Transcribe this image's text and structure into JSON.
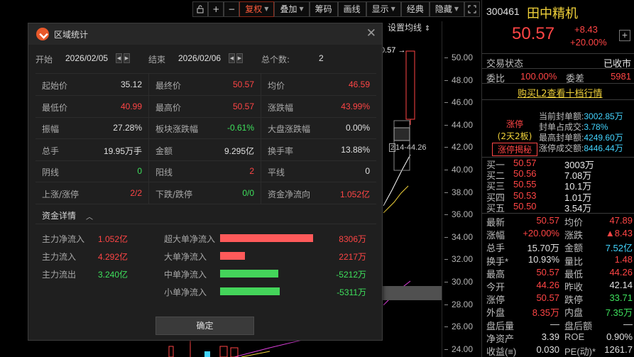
{
  "toolbar": {
    "fuquan": "复权",
    "diejia": "叠加",
    "chouma": "筹码",
    "huaxian": "画线",
    "xianshi": "显示",
    "jingdian": "经典",
    "yincang": "隐藏"
  },
  "chart": {
    "ma_setting": "设置均线",
    "price_marker": "0.57 →",
    "range_label": "14-44.26",
    "axis_ticks": [
      "50.00",
      "48.00",
      "46.00",
      "44.00",
      "42.00",
      "40.00",
      "38.00",
      "36.00",
      "34.00",
      "32.00",
      "30.00",
      "28.00",
      "26.00",
      "24.00"
    ]
  },
  "quote": {
    "code": "300461",
    "name": "田中精机",
    "price": "50.57",
    "change": "+8.43",
    "change_pct": "+20.00%",
    "trade_status_label": "交易状态",
    "trade_status": "已收市",
    "weibi_label": "委比",
    "weibi": "100.00%",
    "weicha_label": "委差",
    "weicha": "5981",
    "l2_link": "购买L2查看十档行情",
    "limit_up": "涨停",
    "limit_days": "(2天2板)",
    "limit_reveal": "涨停揭秘",
    "seal_lines": [
      {
        "label": "当前封单额:",
        "value": "3002.85万"
      },
      {
        "label": "封单占成交:",
        "value": "3.78%"
      },
      {
        "label": "最高封单额:",
        "value": "4249.60万"
      },
      {
        "label": "涨停成交额:",
        "value": "8446.44万"
      }
    ],
    "bids": [
      {
        "label": "买一",
        "price": "50.57",
        "vol": "3003万"
      },
      {
        "label": "买二",
        "price": "50.56",
        "vol": "7.08万"
      },
      {
        "label": "买三",
        "price": "50.55",
        "vol": "10.1万"
      },
      {
        "label": "买四",
        "price": "50.53",
        "vol": "1.01万"
      },
      {
        "label": "买五",
        "price": "50.50",
        "vol": "3.54万"
      }
    ],
    "detail": [
      {
        "l1": "最新",
        "v1": "50.57",
        "c1": "red",
        "l2": "均价",
        "v2": "47.89",
        "c2": "red"
      },
      {
        "l1": "涨幅",
        "v1": "+20.00%",
        "c1": "red",
        "l2": "涨跌",
        "v2": "▲8.43",
        "c2": "red"
      },
      {
        "l1": "总手",
        "v1": "15.70万",
        "c1": "white",
        "l2": "金额",
        "v2": "7.52亿",
        "c2": "cyan"
      },
      {
        "l1": "换手*",
        "v1": "10.93%",
        "c1": "white",
        "l2": "量比",
        "v2": "1.48",
        "c2": "red"
      },
      {
        "l1": "最高",
        "v1": "50.57",
        "c1": "red",
        "l2": "最低",
        "v2": "44.26",
        "c2": "red"
      },
      {
        "l1": "今开",
        "v1": "44.26",
        "c1": "red",
        "l2": "昨收",
        "v2": "42.14",
        "c2": "white"
      },
      {
        "l1": "涨停",
        "v1": "50.57",
        "c1": "red",
        "l2": "跌停",
        "v2": "33.71",
        "c2": "green"
      },
      {
        "l1": "外盘",
        "v1": "8.35万",
        "c1": "red",
        "l2": "内盘",
        "v2": "7.35万",
        "c2": "green"
      },
      {
        "l1": "盘后量",
        "v1": "—",
        "c1": "white",
        "l2": "盘后额",
        "v2": "—",
        "c2": "white"
      },
      {
        "l1": "净资产",
        "v1": "3.39",
        "c1": "white",
        "l2": "ROE",
        "v2": "0.90%",
        "c2": "white"
      },
      {
        "l1": "收益(≡)",
        "v1": "0.030",
        "c1": "white",
        "l2": "PE(动)*",
        "v2": "1261.7",
        "c2": "white"
      }
    ]
  },
  "dialog": {
    "title": "区域统计",
    "start_label": "开始",
    "start_date": "2026/02/05",
    "end_label": "结束",
    "end_date": "2026/02/06",
    "count_label": "总个数:",
    "count": "2",
    "stats": [
      [
        {
          "label": "起始价",
          "value": "35.12",
          "color": "white"
        },
        {
          "label": "最终价",
          "value": "50.57",
          "color": "red"
        },
        {
          "label": "均价",
          "value": "46.59",
          "color": "red"
        }
      ],
      [
        {
          "label": "最低价",
          "value": "40.99",
          "color": "red"
        },
        {
          "label": "最高价",
          "value": "50.57",
          "color": "red"
        },
        {
          "label": "涨跌幅",
          "value": "43.99%",
          "color": "red"
        }
      ],
      [
        {
          "label": "振幅",
          "value": "27.28%",
          "color": "white"
        },
        {
          "label": "板块涨跌幅",
          "value": "-0.61%",
          "color": "green"
        },
        {
          "label": "大盘涨跌幅",
          "value": "0.00%",
          "color": "white"
        }
      ],
      [
        {
          "label": "总手",
          "value": "19.95万手",
          "color": "white"
        },
        {
          "label": "金额",
          "value": "9.295亿",
          "color": "white"
        },
        {
          "label": "换手率",
          "value": "13.88%",
          "color": "white"
        }
      ],
      [
        {
          "label": "阴线",
          "value": "0",
          "color": "green"
        },
        {
          "label": "阳线",
          "value": "2",
          "color": "red"
        },
        {
          "label": "平线",
          "value": "0",
          "color": "white"
        }
      ],
      [
        {
          "label": "上涨/涨停",
          "value": "2/2",
          "color": "red"
        },
        {
          "label": "下跌/跌停",
          "value": "0/0",
          "color": "green"
        },
        {
          "label": "资金净流向",
          "value": "1.052亿",
          "color": "red"
        }
      ]
    ],
    "fund_title": "资金详情",
    "fund_left": [
      {
        "label": "主力净流入",
        "value": "1.052亿",
        "color": "red"
      },
      {
        "label": "主力流入",
        "value": "4.292亿",
        "color": "red"
      },
      {
        "label": "主力流出",
        "value": "3.240亿",
        "color": "green"
      }
    ],
    "fund_right": [
      {
        "label": "超大单净流入",
        "value": "8306万",
        "amount": 8306,
        "color": "red"
      },
      {
        "label": "大单净流入",
        "value": "2217万",
        "amount": 2217,
        "color": "red"
      },
      {
        "label": "中单净流入",
        "value": "-5212万",
        "amount": -5212,
        "color": "green"
      },
      {
        "label": "小单净流入",
        "value": "-5311万",
        "amount": -5311,
        "color": "green"
      }
    ],
    "ok": "确定"
  },
  "colors": {
    "red": "#ff4545",
    "green": "#3ee05c",
    "bar_red": "#ff5a5a",
    "bar_green": "#44d45a",
    "cyan": "#43d4ff",
    "yellow": "#f1d23a"
  }
}
